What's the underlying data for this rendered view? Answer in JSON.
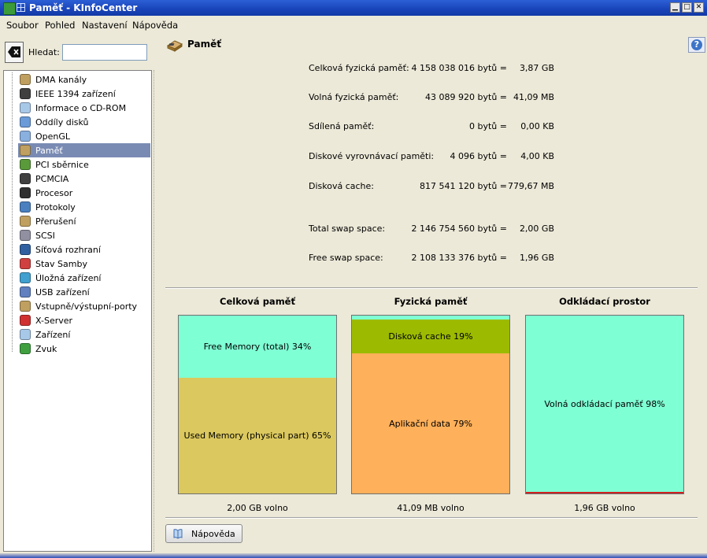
{
  "window": {
    "title": "Paměť - KInfoCenter"
  },
  "menu": [
    "Soubor",
    "Pohled",
    "Nastavení",
    "Nápověda"
  ],
  "search": {
    "label": "Hledat:",
    "value": ""
  },
  "tree": [
    {
      "label": "DMA kanály",
      "icon": "dma-icon",
      "color": "#c0a060"
    },
    {
      "label": "IEEE 1394 zařízení",
      "icon": "ieee1394-icon",
      "color": "#404040"
    },
    {
      "label": "Informace o CD-ROM",
      "icon": "cdrom-icon",
      "color": "#a8c8e8"
    },
    {
      "label": "Oddíly disků",
      "icon": "partitions-icon",
      "color": "#6a9ad8"
    },
    {
      "label": "OpenGL",
      "icon": "opengl-icon",
      "color": "#8ab0e0"
    },
    {
      "label": "Paměť",
      "icon": "memory-icon",
      "color": "#c0a060"
    },
    {
      "label": "PCI sběrnice",
      "icon": "pci-icon",
      "color": "#5a9a3a"
    },
    {
      "label": "PCMCIA",
      "icon": "pcmcia-icon",
      "color": "#404040"
    },
    {
      "label": "Procesor",
      "icon": "processor-icon",
      "color": "#303030"
    },
    {
      "label": "Protokoly",
      "icon": "protocols-icon",
      "color": "#4a80c0"
    },
    {
      "label": "Přerušení",
      "icon": "interrupts-icon",
      "color": "#c0a060"
    },
    {
      "label": "SCSI",
      "icon": "scsi-icon",
      "color": "#9090a0"
    },
    {
      "label": "Síťová rozhraní",
      "icon": "network-icon",
      "color": "#3060a0"
    },
    {
      "label": "Stav Samby",
      "icon": "samba-icon",
      "color": "#d04040"
    },
    {
      "label": "Úložná zařízení",
      "icon": "storage-icon",
      "color": "#40a0d0"
    },
    {
      "label": "USB zařízení",
      "icon": "usb-icon",
      "color": "#6080c0"
    },
    {
      "label": "Vstupně/výstupní-porty",
      "icon": "io-ports-icon",
      "color": "#c0a060"
    },
    {
      "label": "X-Server",
      "icon": "xserver-icon",
      "color": "#d03030"
    },
    {
      "label": "Zařízení",
      "icon": "devices-icon",
      "color": "#a8c8e8"
    },
    {
      "label": "Zvuk",
      "icon": "sound-icon",
      "color": "#40a040"
    }
  ],
  "selected_index": 5,
  "page": {
    "title": "Paměť"
  },
  "memory_rows": [
    {
      "key": "Celková fyzická paměť:",
      "bytes": "4 158 038 016 bytů =",
      "value": "3,87 GB"
    },
    {
      "key": "Volná fyzická paměť:",
      "bytes": "43 089 920 bytů =",
      "value": "41,09 MB"
    },
    {
      "key": "Sdílená paměť:",
      "bytes": "0 bytů =",
      "value": "0,00 KB"
    },
    {
      "key": "Diskové vyrovnávací paměti:",
      "bytes": "4 096 bytů =",
      "value": "4,00 KB"
    },
    {
      "key": "Disková cache:",
      "bytes": "817 541 120 bytů =",
      "value": "779,67 MB"
    },
    {
      "key": "Total swap space:",
      "bytes": "2 146 754 560 bytů =",
      "value": "2,00 GB"
    },
    {
      "key": "Free swap space:",
      "bytes": "2 108 133 376 bytů =",
      "value": "1,96 GB"
    }
  ],
  "charts": [
    {
      "title": "Celková paměť",
      "footer": "2,00 GB volno",
      "segments": [
        {
          "label": "Free Memory (total) 34%",
          "fraction": 0.35,
          "color": "#7fffd4"
        },
        {
          "label": "Used Memory (physical part) 65%",
          "fraction": 0.65,
          "color": "#dbc85e"
        }
      ]
    },
    {
      "title": "Fyzická paměť",
      "footer": "41,09 MB volno",
      "segments": [
        {
          "label": "",
          "fraction": 0.02,
          "color": "#7fffd4"
        },
        {
          "label": "Disková cache 19%",
          "fraction": 0.19,
          "color": "#9cbb00"
        },
        {
          "label": "Aplikační data 79%",
          "fraction": 0.79,
          "color": "#ffb05a"
        }
      ]
    },
    {
      "title": "Odkládací prostor",
      "footer": "1,96 GB volno",
      "segments": [
        {
          "label": "Volná odkládací paměť 98%",
          "fraction": 0.99,
          "color": "#7fffd4"
        },
        {
          "label": "",
          "fraction": 0.01,
          "color": "#d02020"
        }
      ]
    }
  ],
  "help_button": {
    "label": "Nápověda"
  }
}
